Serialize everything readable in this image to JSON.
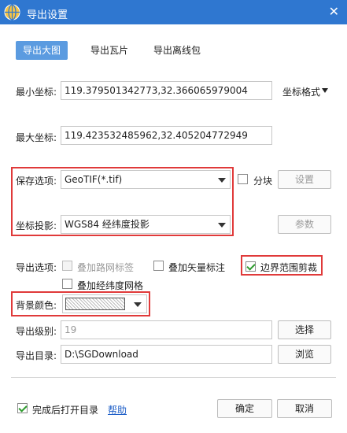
{
  "window": {
    "title": "导出设置",
    "close_glyph": "✕",
    "logo_icon": "globe-icon"
  },
  "tabs": [
    {
      "label": "导出大图",
      "active": true
    },
    {
      "label": "导出瓦片",
      "active": false
    },
    {
      "label": "导出离线包",
      "active": false
    }
  ],
  "min_coord": {
    "label": "最小坐标:",
    "value": "119.379501342773,32.366065979004"
  },
  "coord_format": {
    "label": "坐标格式"
  },
  "max_coord": {
    "label": "最大坐标:",
    "value": "119.423532485962,32.405204772949"
  },
  "save_option": {
    "label": "保存选项:",
    "value": "GeoTIF(*.tif)"
  },
  "tile_split": {
    "label": "分块",
    "checked": false
  },
  "settings_button": {
    "label": "设置"
  },
  "projection": {
    "label": "坐标投影:",
    "value": "WGS84 经纬度投影"
  },
  "params_button": {
    "label": "参数"
  },
  "export_options": {
    "label": "导出选项:",
    "road_label": {
      "label": "叠加路网标签",
      "checked": false,
      "disabled": true
    },
    "vector_label": {
      "label": "叠加矢量标注",
      "checked": false
    },
    "boundary_clip": {
      "label": "边界范围剪裁",
      "checked": true
    },
    "graticule": {
      "label": "叠加经纬度网格",
      "checked": false
    }
  },
  "background_color": {
    "label": "背景颜色:"
  },
  "export_level": {
    "label": "导出级别:",
    "value": "19"
  },
  "select_button": {
    "label": "选择"
  },
  "export_dir": {
    "label": "导出目录:",
    "value": "D:\\SGDownload"
  },
  "browse_button": {
    "label": "浏览"
  },
  "open_after": {
    "label": "完成后打开目录",
    "checked": true
  },
  "help_link": {
    "label": "帮助"
  },
  "ok_button": {
    "label": "确定"
  },
  "cancel_button": {
    "label": "取消"
  },
  "colors": {
    "titlebar": "#2f77d0",
    "active_tab": "#5b9be0",
    "highlight": "#e03a3a",
    "check": "#2e9b2e",
    "link": "#2060c8"
  }
}
